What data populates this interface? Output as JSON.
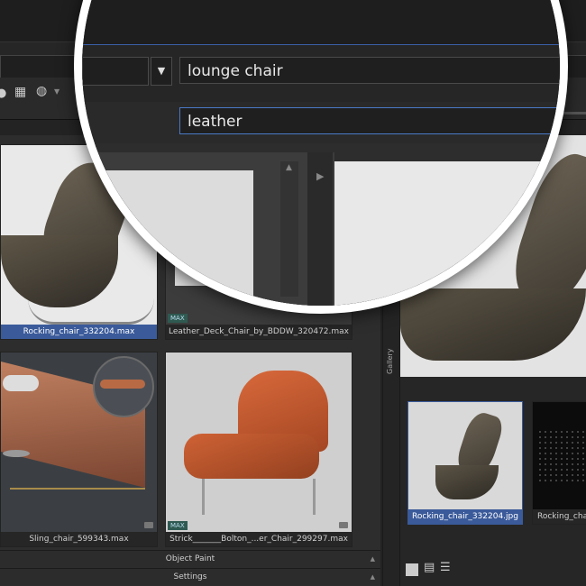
{
  "search": {
    "name_value": "lounge chair",
    "material_value": "leather"
  },
  "library": {
    "items": [
      {
        "caption": "Rocking_chair_332204.max",
        "selected": true,
        "badge": ""
      },
      {
        "caption": "Leather_Deck_Chair_by_BDDW_320472.max",
        "selected": false,
        "badge": "MAX"
      },
      {
        "caption": "Sling_chair_599343.max",
        "selected": false,
        "badge": ""
      },
      {
        "caption": "Strick_______Bolton_...er_Chair_299297.max",
        "selected": false,
        "badge": "MAX"
      }
    ]
  },
  "panels": {
    "object_paint": "Object Paint",
    "settings": "Settings",
    "gallery": "Gallery"
  },
  "gallery": {
    "items": [
      {
        "caption": "Rocking_chair_332204.jpg",
        "selected": true
      },
      {
        "caption": "Rocking_chai",
        "selected": false
      }
    ]
  },
  "icons": [
    "dropdown-arrow-icon",
    "grid-view-icon",
    "globe-icon",
    "tag-icon",
    "gallery-layout-icon",
    "list-view-icon"
  ],
  "colors": {
    "accent": "#3a5a9a",
    "focus_border": "#4a79c6",
    "badge": "#2f5a52"
  }
}
